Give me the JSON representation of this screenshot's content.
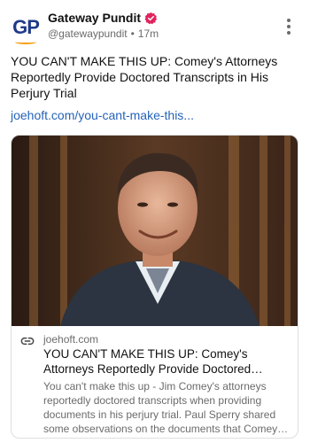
{
  "account": {
    "avatar_text": "GP",
    "display_name": "Gateway Pundit",
    "handle": "@gatewaypundit",
    "separator": "•",
    "time_ago": "17m",
    "verified_icon": "verified-badge-icon",
    "more_icon": "more-vertical-icon"
  },
  "post": {
    "text": "YOU CAN'T MAKE THIS UP: Comey's Attorneys Reportedly Provide Doctored Transcripts in His Perjury Trial",
    "link_text": "joehoft.com/you-cant-make-this..."
  },
  "link_card": {
    "image_description_icon": "photo-of-man",
    "link_icon": "link-icon",
    "domain": "joehoft.com",
    "title": "YOU CAN'T MAKE THIS UP: Comey's Attorneys Reportedly Provide Doctored Transcripts in His...",
    "description": "You can't make this up - Jim Comey's attorneys reportedly doctored transcripts when providing documents in his perjury trial. Paul Sperry shared some observations on the documents that Comey provided ..."
  },
  "colors": {
    "link": "#2563b8",
    "verified": "#e0245e",
    "brand": "#1f3a8a",
    "muted": "#6b6b6b"
  }
}
